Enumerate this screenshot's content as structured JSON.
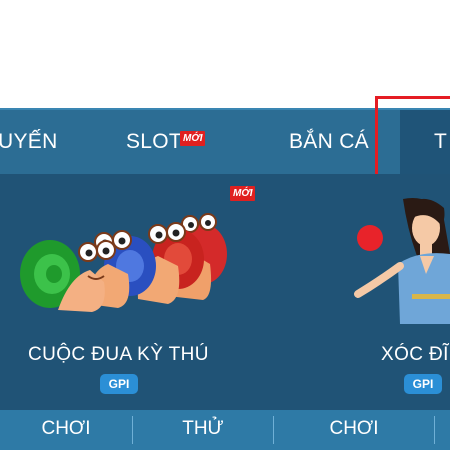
{
  "nav": {
    "items": [
      {
        "label": "UYẾN"
      },
      {
        "label": "SLOT",
        "badge": "MỚI"
      },
      {
        "label": "BẮN CÁ"
      },
      {
        "label": "T"
      }
    ]
  },
  "games": [
    {
      "title": "CUỘC ĐUA KỲ THÚ",
      "provider": "GPI",
      "badge": "MỚI"
    },
    {
      "title": "XÓC ĐĨ",
      "provider": "GPI"
    }
  ],
  "actions": [
    {
      "label": "CHƠI"
    },
    {
      "label": "THỬ"
    },
    {
      "label": "CHƠI"
    }
  ],
  "colors": {
    "nav_bg": "#2c6d94",
    "panel_bg": "#205376",
    "action_bg": "#2e7aa6",
    "badge": "#e02020",
    "highlight": "#e51c23"
  }
}
